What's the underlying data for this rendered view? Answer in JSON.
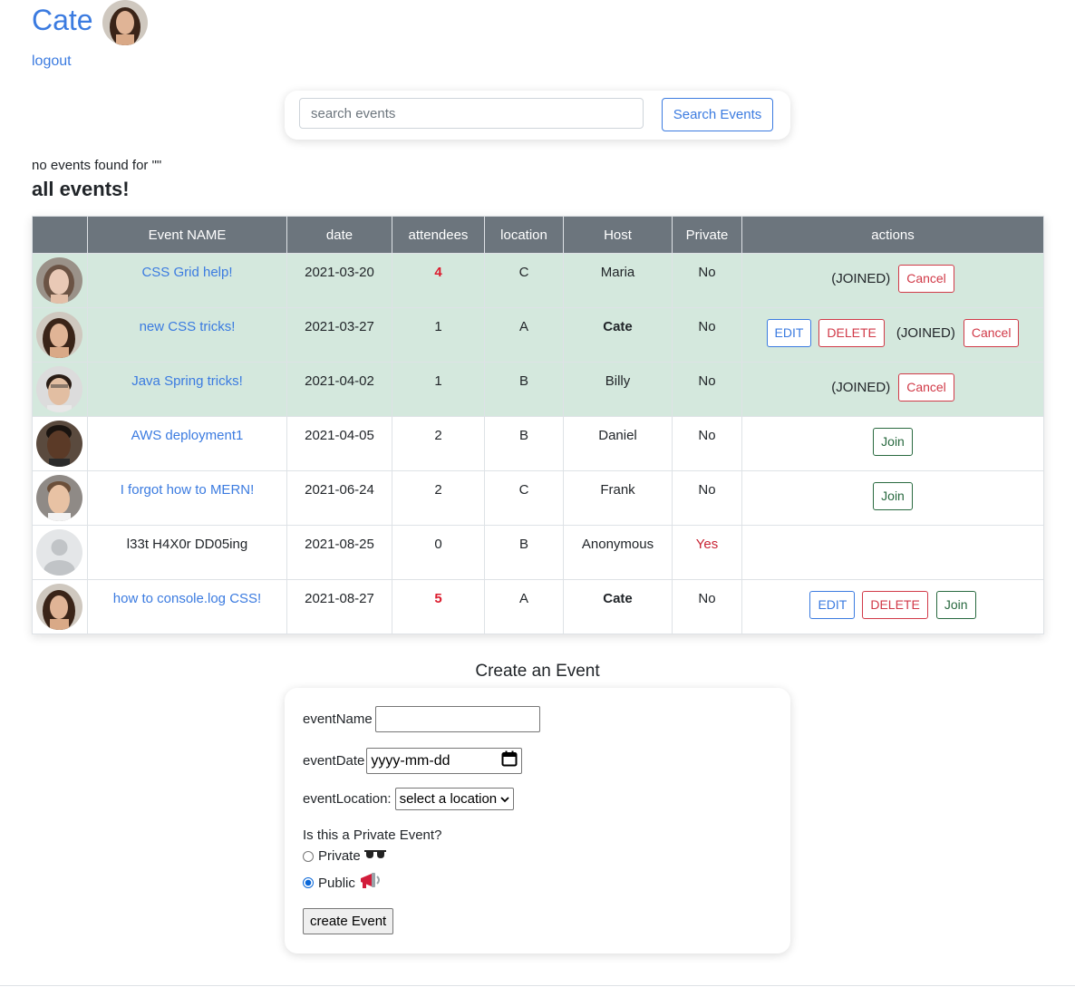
{
  "header": {
    "username": "Cate",
    "logout_label": "logout"
  },
  "search": {
    "placeholder": "search events",
    "value": "",
    "button_label": "Search Events"
  },
  "results_message": "no events found for \"\"",
  "list_title": "all events!",
  "table": {
    "columns": [
      "",
      "Event NAME",
      "date",
      "attendees",
      "location",
      "Host",
      "Private",
      "actions"
    ],
    "rows": [
      {
        "event_name": "CSS Grid help!",
        "date": "2021-03-20",
        "attendees": "4",
        "location": "C",
        "host": "Maria",
        "private": "No"
      },
      {
        "event_name": "new CSS tricks!",
        "date": "2021-03-27",
        "attendees": "1",
        "location": "A",
        "host": "Cate",
        "private": "No"
      },
      {
        "event_name": "Java Spring tricks!",
        "date": "2021-04-02",
        "attendees": "1",
        "location": "B",
        "host": "Billy",
        "private": "No"
      },
      {
        "event_name": "AWS deployment1",
        "date": "2021-04-05",
        "attendees": "2",
        "location": "B",
        "host": "Daniel",
        "private": "No"
      },
      {
        "event_name": "I forgot how to MERN!",
        "date": "2021-06-24",
        "attendees": "2",
        "location": "C",
        "host": "Frank",
        "private": "No"
      },
      {
        "event_name": "l33t H4X0r DD05ing",
        "date": "2021-08-25",
        "attendees": "0",
        "location": "B",
        "host": "Anonymous",
        "private": "Yes"
      },
      {
        "event_name": "how to console.log CSS!",
        "date": "2021-08-27",
        "attendees": "5",
        "location": "A",
        "host": "Cate",
        "private": "No"
      }
    ],
    "labels": {
      "joined": "(JOINED)",
      "cancel": "Cancel",
      "edit": "EDIT",
      "delete": "DELETE",
      "join": "Join"
    }
  },
  "create_form": {
    "title": "Create an Event",
    "event_name_label": "eventName",
    "event_date_label": "eventDate",
    "event_date_placeholder": "yyyy-mm-dd",
    "event_location_label": "eventLocation:",
    "event_location_selected": "select a location",
    "private_question": "Is this a Private Event?",
    "private_option": "Private",
    "public_option": "Public",
    "selected_privacy": "Public",
    "submit_label": "create Event"
  },
  "colors": {
    "accent": "#3b7be0",
    "danger": "#d13a48",
    "success": "#28693f",
    "header_bg": "#6c757d",
    "joined_row_bg": "#d4e8dd"
  }
}
